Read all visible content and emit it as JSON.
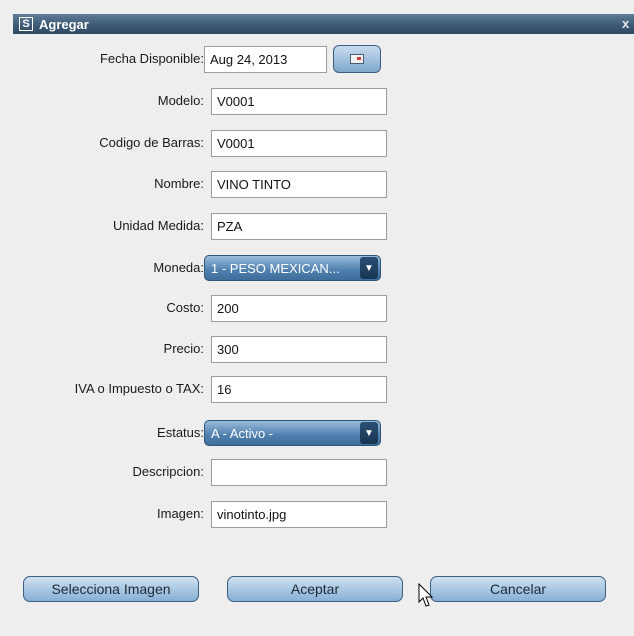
{
  "window": {
    "title": "Agregar",
    "app_icon": "S",
    "close_glyph": "x"
  },
  "form": {
    "fecha": {
      "label": "Fecha Disponible:",
      "value": "Aug 24, 2013"
    },
    "modelo": {
      "label": "Modelo:",
      "value": "V0001"
    },
    "codigo": {
      "label": "Codigo de Barras:",
      "value": "V0001"
    },
    "nombre": {
      "label": "Nombre:",
      "value": "VINO TINTO"
    },
    "unidad": {
      "label": "Unidad Medida:",
      "value": "PZA"
    },
    "moneda": {
      "label": "Moneda:",
      "value": "1 - PESO MEXICAN..."
    },
    "costo": {
      "label": "Costo:",
      "value": "200"
    },
    "precio": {
      "label": "Precio:",
      "value": "300"
    },
    "iva": {
      "label": "IVA o Impuesto o TAX:",
      "value": "16"
    },
    "estatus": {
      "label": "Estatus:",
      "value": "A - Activo -"
    },
    "descripcion": {
      "label": "Descripcion:",
      "value": ""
    },
    "imagen": {
      "label": "Imagen:",
      "value": "vinotinto.jpg"
    }
  },
  "buttons": {
    "selecciona": "Selecciona Imagen",
    "aceptar": "Aceptar",
    "cancelar": "Cancelar"
  },
  "icons": {
    "calendar": "calendar-icon",
    "dropdown": "chevron-down-icon",
    "cursor": "mouse-pointer-icon"
  },
  "colors": {
    "titlebar": "#3d5a76",
    "button_gradient_top": "#cfe0f0",
    "button_gradient_bottom": "#86b0d6",
    "combo": "#4f7fae"
  }
}
